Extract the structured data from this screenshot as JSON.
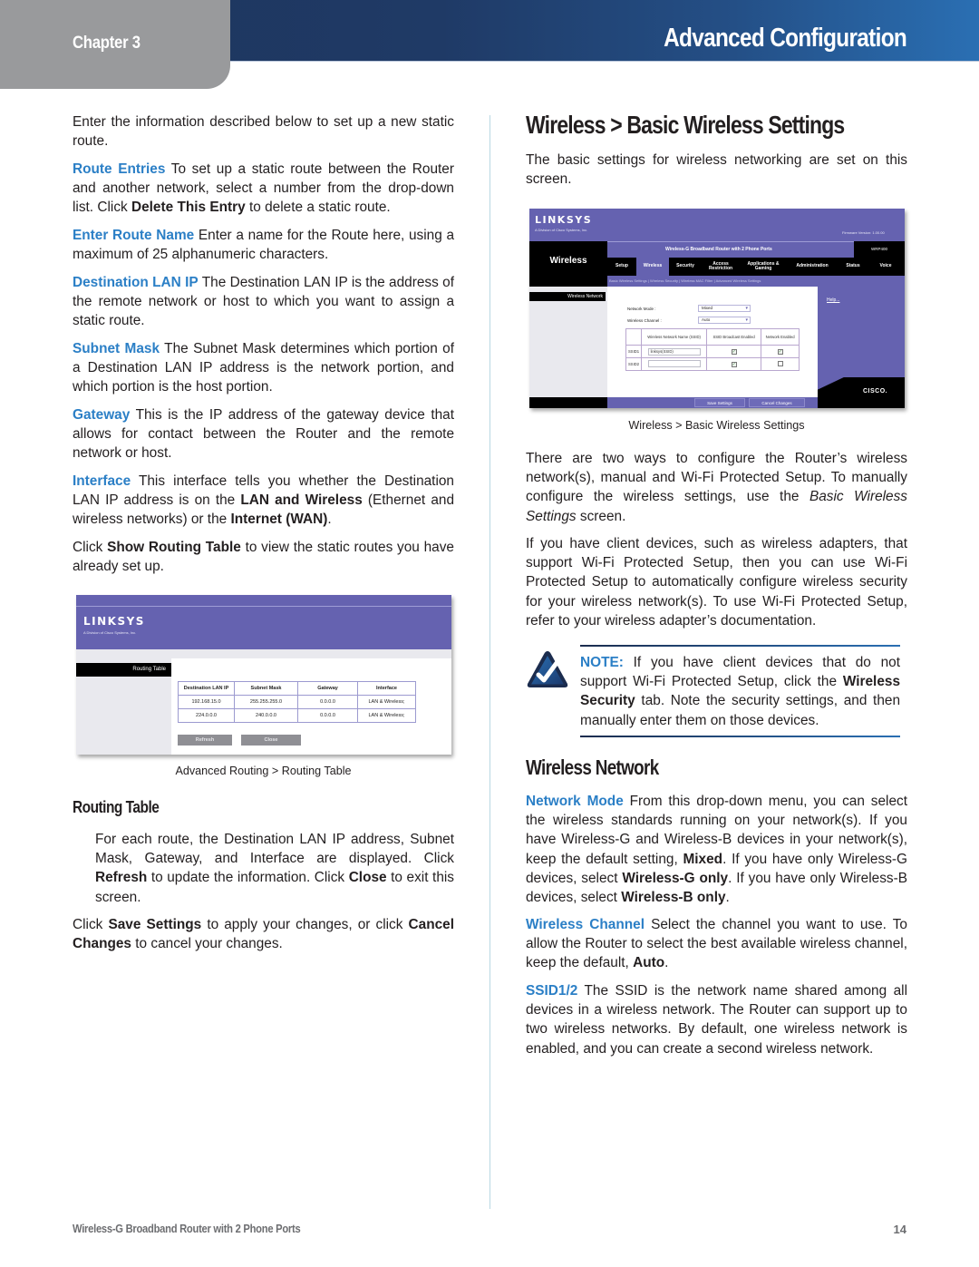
{
  "header": {
    "chapter_label": "Chapter 3",
    "title": "Advanced Configuration"
  },
  "left_column": {
    "intro": "Enter the information described below to set up a new static route.",
    "route_entries": {
      "term": "Route Entries",
      "text_1": " To set up a static route between the Router and another network, select a number from the drop-down list. Click ",
      "bold_1": "Delete This Entry",
      "text_2": " to delete a static route."
    },
    "enter_route_name": {
      "term": "Enter Route Name",
      "text": " Enter a name for the Route here, using a maximum of 25 alphanumeric characters."
    },
    "destination_lan_ip": {
      "term": "Destination LAN IP",
      "text": " The Destination LAN IP is the address of the remote network or host to which you want to assign a static route."
    },
    "subnet_mask": {
      "term": "Subnet Mask",
      "text": " The Subnet Mask determines which portion of a Destination LAN IP address is the network portion, and which portion is the host portion."
    },
    "gateway": {
      "term": "Gateway",
      "text": " This is the IP address of the gateway device that allows for contact between the Router and the remote network or host."
    },
    "interface": {
      "term": "Interface",
      "text_1": " This interface tells you whether the Destination LAN IP address is on the ",
      "bold_1": "LAN and Wireless",
      "text_2": " (Ethernet and wireless networks) or the ",
      "bold_2": "Internet (WAN)",
      "text_3": "."
    },
    "show_routing": {
      "text_1": "Click ",
      "bold_1": "Show Routing Table",
      "text_2": " to view the static routes you have already set up."
    },
    "routing_screenshot": {
      "logo": "LINKSYS",
      "logo_sub": "A Division of Cisco Systems, Inc.",
      "sidebar_label": "Routing Table",
      "columns": [
        "Destination LAN IP",
        "Subnet Mask",
        "Gateway",
        "Interface"
      ],
      "rows": [
        [
          "192.168.15.0",
          "255.255.255.0",
          "0.0.0.0",
          "LAN & Wireless;"
        ],
        [
          "224.0.0.0",
          "240.0.0.0",
          "0.0.0.0",
          "LAN & Wireless;"
        ]
      ],
      "refresh_button": "Refresh",
      "close_button": "Close"
    },
    "routing_caption": "Advanced Routing > Routing Table",
    "routing_table_heading": "Routing Table",
    "routing_table_desc": {
      "text_1": "For each route, the Destination LAN IP address, Subnet Mask, Gateway, and Interface are displayed. Click ",
      "bold_1": "Refresh",
      "text_2": " to update the information. Click ",
      "bold_2": "Close",
      "text_3": " to exit this screen."
    },
    "save_note": {
      "text_1": "Click ",
      "bold_1": "Save Settings",
      "text_2": " to apply your changes, or click ",
      "bold_2": "Cancel Changes",
      "text_3": " to cancel your changes."
    }
  },
  "right_column": {
    "section_title": "Wireless > Basic Wireless Settings",
    "intro": "The basic settings for wireless networking are set on this screen.",
    "wireless_screenshot": {
      "logo": "LINKSYS",
      "logo_sub": "A Division of Cisco Systems, Inc.",
      "firmware": "Firmware Version: 1.00.00",
      "section": "Wireless",
      "product_name": "Wireless-G Broadband Router with 2 Phone Ports",
      "model": "WRP400",
      "tabs": [
        "Setup",
        "Wireless",
        "Security",
        "Access Restriction",
        "Applications & Gaming",
        "Administration",
        "Status",
        "Voice"
      ],
      "active_tab": "Wireless",
      "subnav": "Basic Wireless Settings  |  Wireless Security  |  Wireless MAC Filter  |  Advanced Wireless Settings",
      "subsection": "Wireless Network",
      "help_link": "Help...",
      "network_mode_label": "Network Mode :",
      "network_mode_value": "Mixed",
      "channel_label": "Wireless Channel :",
      "channel_value": "Auto",
      "table_headers": [
        "",
        "Wireless Network Name (SSID)",
        "SSID Broadcast Enabled",
        "Network Enabled"
      ],
      "ssid_rows": [
        {
          "label": "SSID1",
          "name": "linksys(SSID)",
          "broadcast": true,
          "enabled": true
        },
        {
          "label": "SSID2",
          "name": "",
          "broadcast": true,
          "enabled": false
        }
      ],
      "save_button": "Save Settings",
      "cancel_button": "Cancel Changes",
      "cisco_logo": "CISCO."
    },
    "wireless_caption": "Wireless > Basic Wireless Settings",
    "two_ways": {
      "text_1": "There are two ways to configure the Router’s wireless network(s), manual and Wi-Fi Protected Setup. To manually configure the wireless settings, use the ",
      "italic_1": "Basic Wireless Settings",
      "text_2": " screen."
    },
    "client_devices": "If you have client devices, such as wireless adapters, that support Wi-Fi Protected Setup, then you can use Wi-Fi Protected Setup to automatically configure wireless security for your wireless network(s). To use Wi-Fi Protected Setup, refer to your wireless adapter’s documentation.",
    "note": {
      "icon": "checkmark-triangle-icon",
      "label": "NOTE:",
      "text_1": " If you have client devices that do not support Wi-Fi Protected Setup, click the ",
      "bold_1": "Wireless Security",
      "text_2": " tab. Note the security settings, and then manually enter them on those devices."
    },
    "wireless_network_heading": "Wireless Network",
    "network_mode": {
      "term": "Network Mode",
      "text_1": " From this drop-down menu, you can select the wireless standards running on your network(s). If you have Wireless-G and Wireless-B devices in your network(s), keep the default setting, ",
      "bold_1": "Mixed",
      "text_2": ". If you have only Wireless-G devices, select ",
      "bold_2": "Wireless-G only",
      "text_3": ". If you have only Wireless-B devices, select ",
      "bold_3": "Wireless-B only",
      "text_4": "."
    },
    "wireless_channel": {
      "term": "Wireless Channel",
      "text_1": " Select the channel you want to use. To allow the Router to select the best available wireless channel, keep the default, ",
      "bold_1": "Auto",
      "text_2": "."
    },
    "ssid": {
      "term": "SSID1/2",
      "text": " The SSID is the network name shared among all devices in a wireless network. The Router can support up to two wireless networks. By default, one wireless network is enabled, and you can create a second wireless network."
    }
  },
  "footer": {
    "product": "Wireless-G Broadband Router with 2 Phone Ports",
    "page_number": "14"
  },
  "colors": {
    "header_dark": "#1e355c",
    "header_light": "#2a6fb3",
    "chapter_tab": "#999a9c",
    "term_blue": "#2b7fc6",
    "linksys_purple": "#6562b0"
  }
}
